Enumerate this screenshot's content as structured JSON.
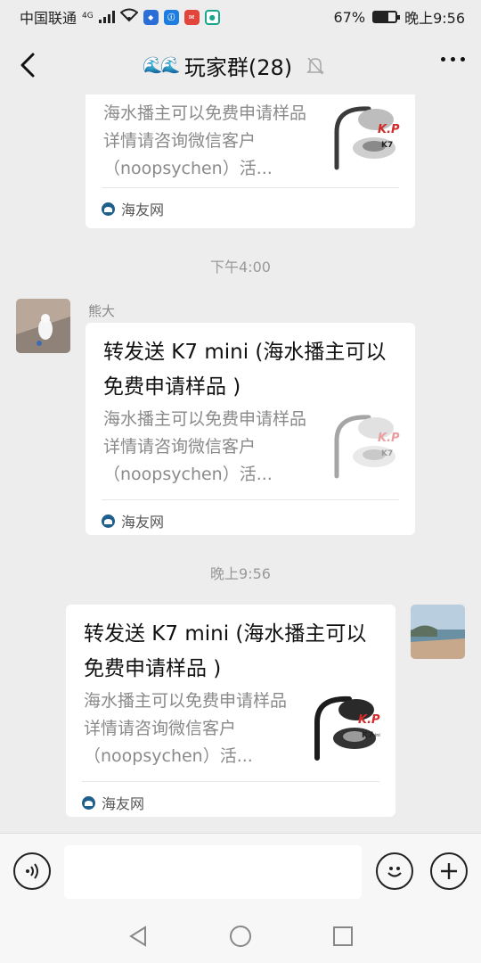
{
  "status": {
    "carrier": "中国联通",
    "network": "4G",
    "battery": "67%",
    "battery_level": 0.67,
    "time": "晚上9:56"
  },
  "header": {
    "title": "玩家群(28)",
    "title_emoji": "🌊🌊"
  },
  "messages": [
    {
      "desc": "海水播主可以免费申请样品详情请咨询微信客户（noopsychen）活...",
      "source": "海友网"
    },
    {
      "timestamp": "下午4:00",
      "sender": "熊大",
      "title": "转发送 K7 mini (海水播主可以免费申请样品 )",
      "desc": "海水播主可以免费申请样品详情请咨询微信客户（noopsychen）活...",
      "source": "海友网"
    },
    {
      "timestamp": "晚上9:56",
      "title": "转发送 K7 mini (海水播主可以免费申请样品 )",
      "desc": "海水播主可以免费申请样品详情请咨询微信客户（noopsychen）活...",
      "source": "海友网"
    }
  ],
  "thumb": {
    "logo": "K.P",
    "model": "K7",
    "model_suffix": "mini"
  },
  "input": {
    "value": "",
    "placeholder": ""
  },
  "colors": {
    "background": "#ededed",
    "card": "#ffffff",
    "input_bar": "#f7f7f7",
    "source_icon": "#1f5f8b",
    "logo_red": "#d22b2b"
  },
  "icons": {
    "back": "chevron-left-icon",
    "mute": "bell-off-icon",
    "more": "more-dots-icon",
    "voice": "voice-icon",
    "emoji": "emoji-icon",
    "plus": "plus-icon",
    "nav_back": "triangle-back-icon",
    "nav_home": "circle-home-icon",
    "nav_recent": "square-recent-icon"
  }
}
